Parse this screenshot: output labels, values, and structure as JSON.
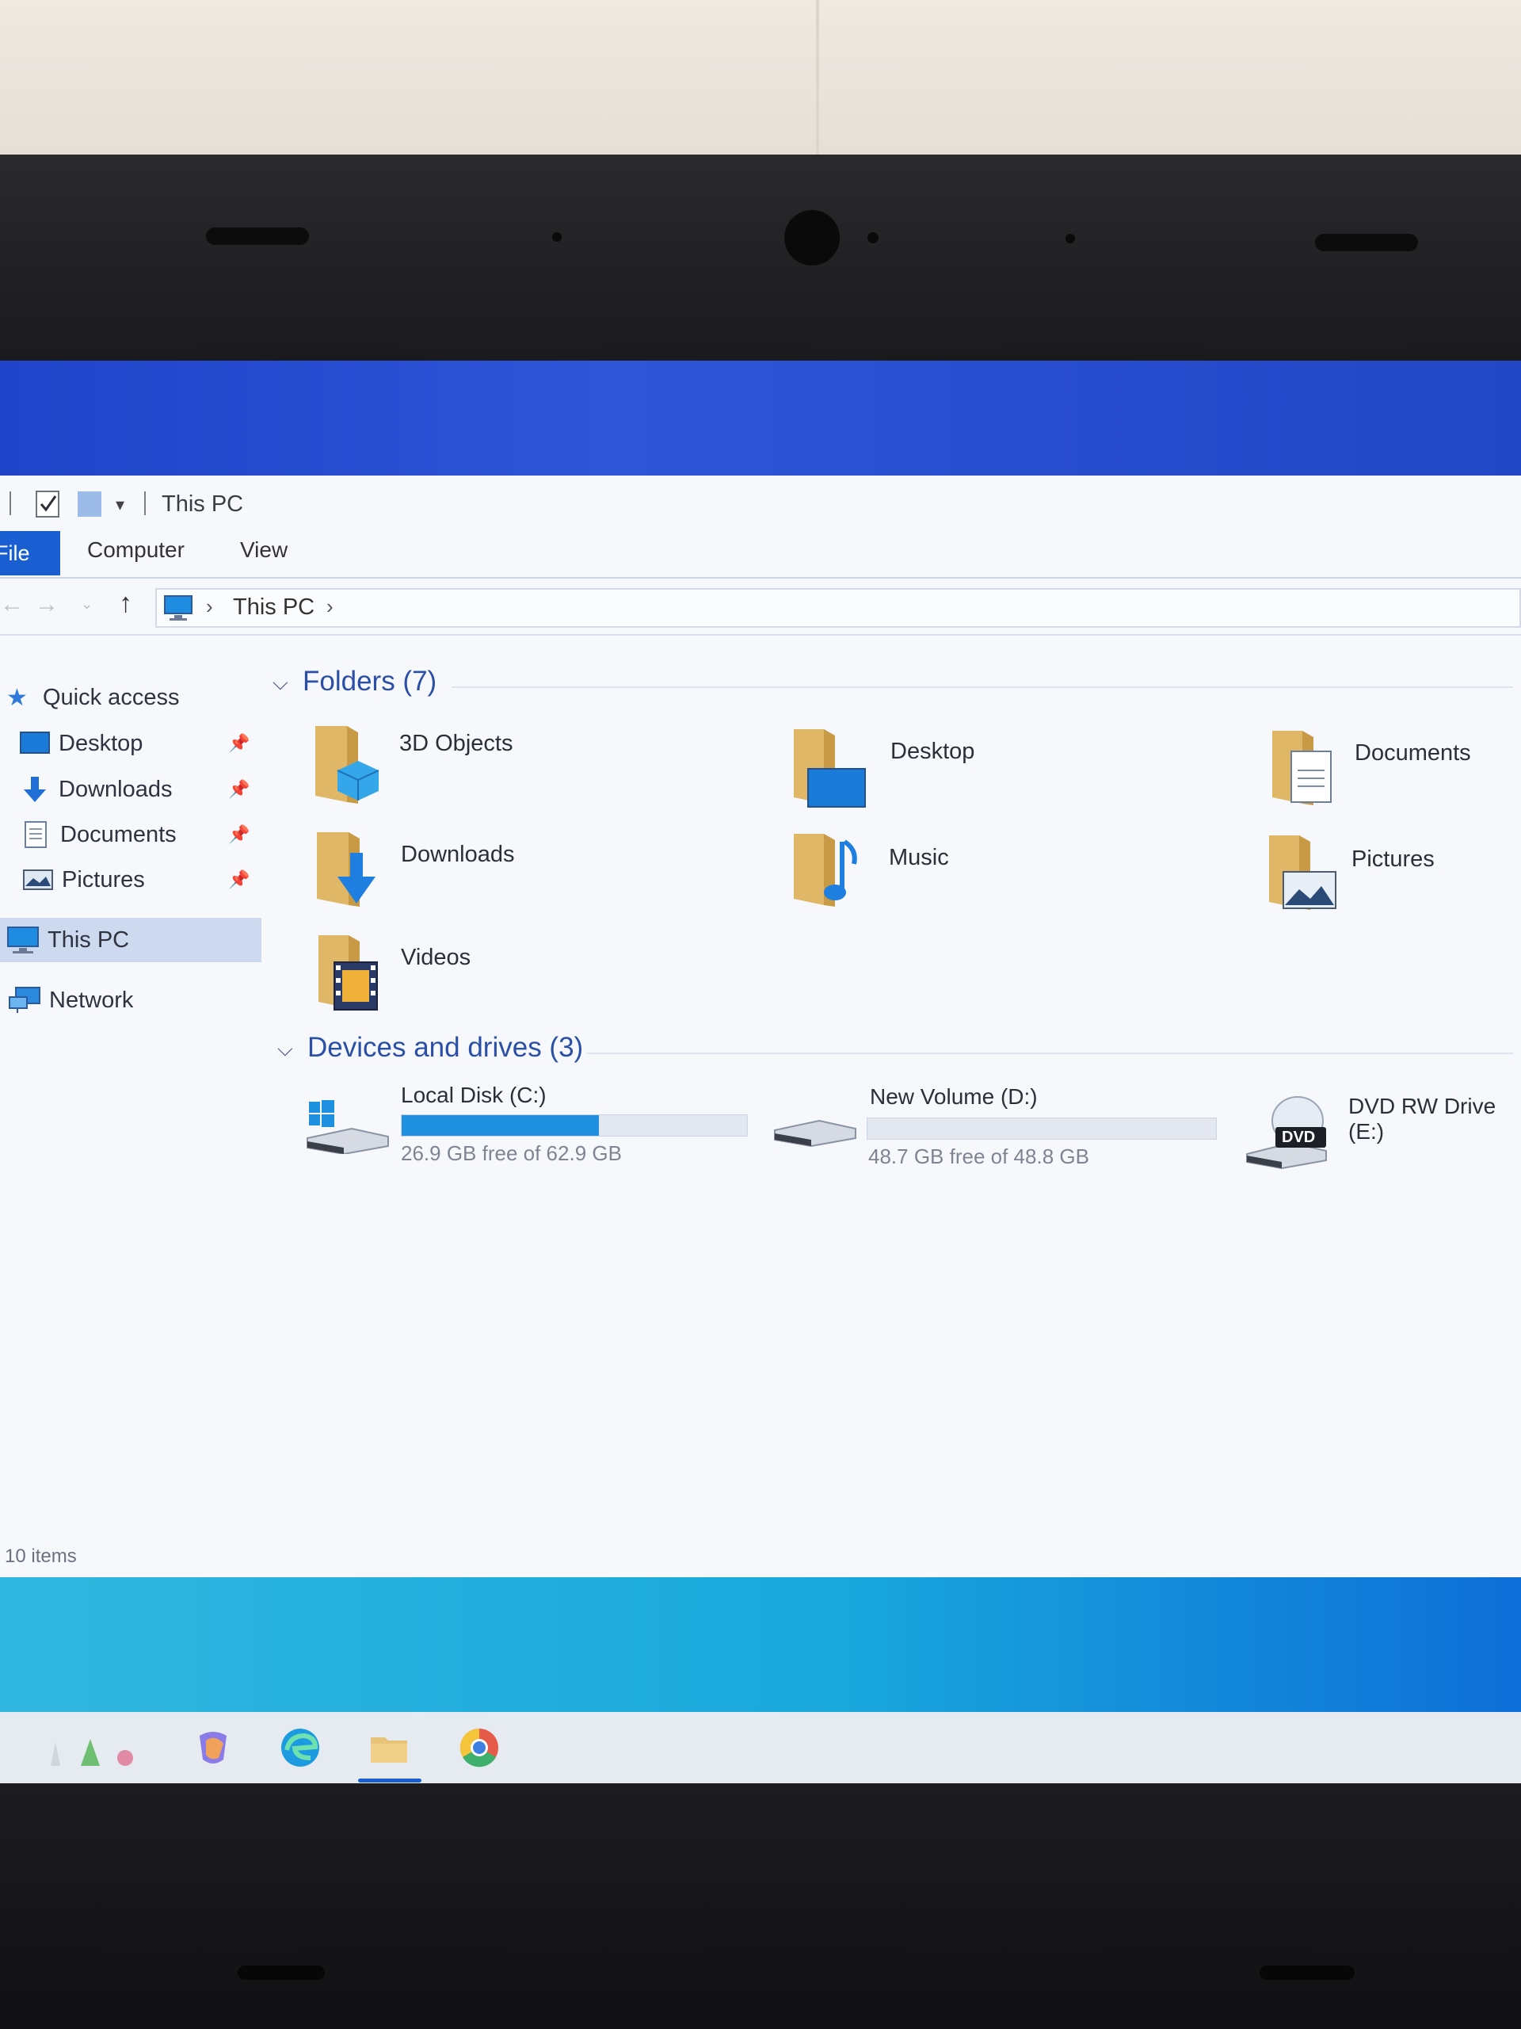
{
  "window": {
    "title": "This PC",
    "tabs": [
      "File",
      "Computer",
      "View"
    ],
    "breadcrumb": [
      "This PC"
    ]
  },
  "nav": {
    "quick_access": "Quick access",
    "pinned": [
      "Desktop",
      "Downloads",
      "Documents",
      "Pictures"
    ],
    "this_pc": "This PC",
    "network": "Network"
  },
  "folders": {
    "header": "Folders (7)",
    "items": [
      "3D Objects",
      "Desktop",
      "Documents",
      "Downloads",
      "Music",
      "Pictures",
      "Videos"
    ]
  },
  "drives": {
    "header": "Devices and drives (3)",
    "items": [
      {
        "name": "Local Disk (C:)",
        "free_text": "26.9 GB free of 62.9 GB",
        "used_fraction": 0.57
      },
      {
        "name": "New Volume (D:)",
        "free_text": "48.7 GB free of 48.8 GB",
        "used_fraction": 0.0
      },
      {
        "name": "DVD RW Drive (E:)",
        "badge": "DVD"
      }
    ]
  },
  "status": {
    "items_count": "10 items"
  },
  "colors": {
    "accent": "#1a5fd1",
    "usage_bar": "#1e90df",
    "folder": "#e8c37a"
  }
}
